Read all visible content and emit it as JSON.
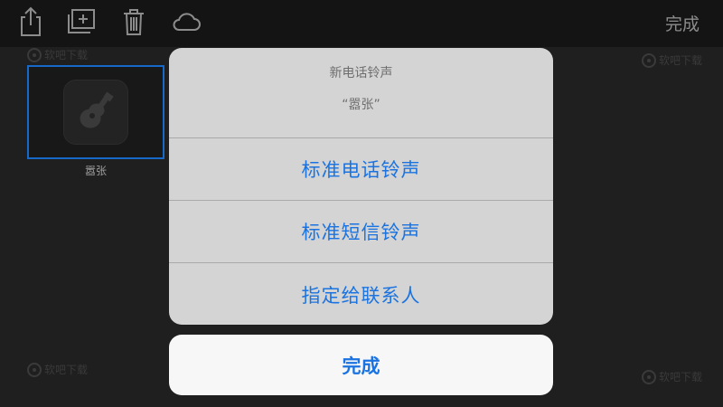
{
  "toolbar": {
    "icons": [
      "share-icon",
      "new-folder-icon",
      "trash-icon",
      "cloud-icon"
    ],
    "done_label": "完成"
  },
  "documents": [
    {
      "name": "嚣张",
      "selected": true
    }
  ],
  "watermark_text": "软吧下载",
  "action_sheet": {
    "title": "新电话铃声",
    "subtitle": "“嚣张”",
    "options": [
      {
        "label": "标准电话铃声"
      },
      {
        "label": "标准短信铃声"
      },
      {
        "label": "指定给联系人"
      }
    ],
    "cancel_label": "完成"
  },
  "colors": {
    "accent": "#1a73e0",
    "selection_border": "#1769c9",
    "sheet_bg": "#d4d4d4",
    "cancel_bg": "#f7f7f7",
    "toolbar_bg": "#141414"
  }
}
